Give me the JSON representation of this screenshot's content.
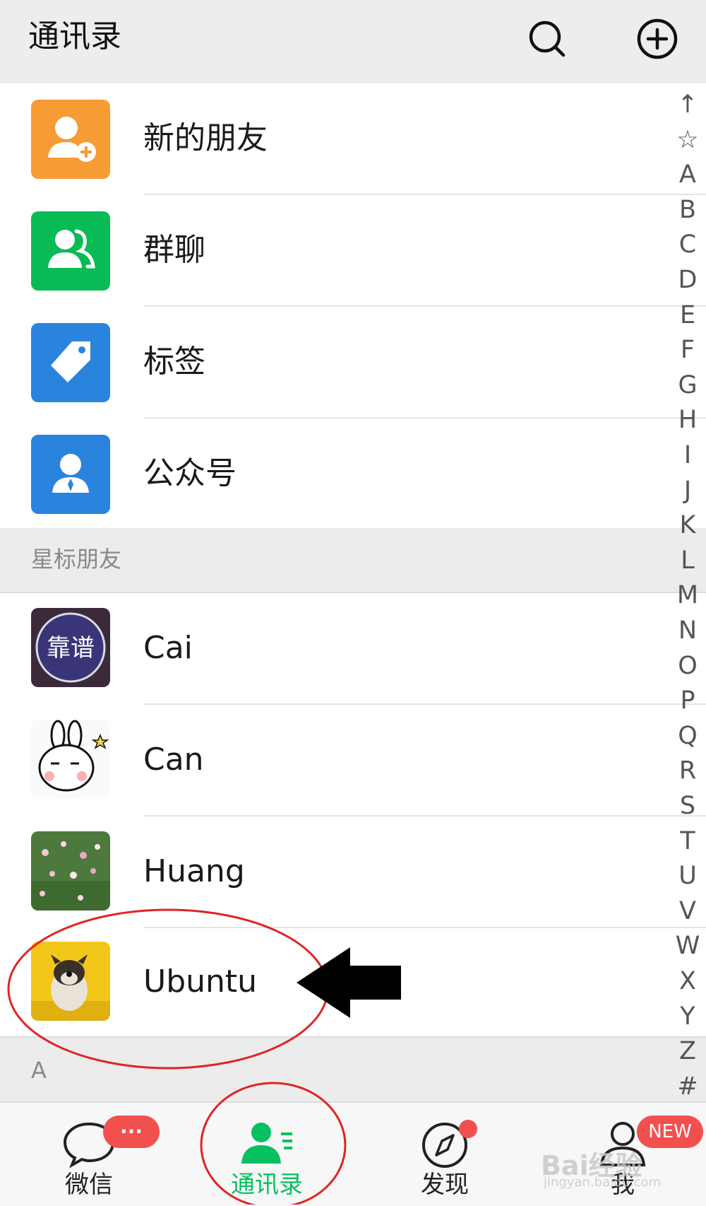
{
  "header": {
    "title": "通讯录",
    "search_icon": "search-icon",
    "add_icon": "plus-circle-icon"
  },
  "menu": [
    {
      "label": "新的朋友",
      "icon": "add-friend-icon",
      "color": "#f79c35"
    },
    {
      "label": "群聊",
      "icon": "group-icon",
      "color": "#09bb54"
    },
    {
      "label": "标签",
      "icon": "tag-icon",
      "color": "#2a84de"
    },
    {
      "label": "公众号",
      "icon": "official-account-icon",
      "color": "#2a84de"
    }
  ],
  "starred_section": {
    "title": "星标朋友"
  },
  "contacts": [
    {
      "name": "Cai",
      "avatar": "avatar-cai",
      "avatar_text": "靠谱"
    },
    {
      "name": "Can",
      "avatar": "avatar-can"
    },
    {
      "name": "Huang",
      "avatar": "avatar-huang"
    },
    {
      "name": "Ubuntu",
      "avatar": "avatar-ubuntu"
    }
  ],
  "a_section": {
    "title": "A"
  },
  "index_letters": [
    "↑",
    "☆",
    "A",
    "B",
    "C",
    "D",
    "E",
    "F",
    "G",
    "H",
    "I",
    "J",
    "K",
    "L",
    "M",
    "N",
    "O",
    "P",
    "Q",
    "R",
    "S",
    "T",
    "U",
    "V",
    "W",
    "X",
    "Y",
    "Z",
    "#"
  ],
  "tabs": [
    {
      "label": "微信",
      "icon": "chat-bubble-icon",
      "badge": "···",
      "active": false
    },
    {
      "label": "通讯录",
      "icon": "contacts-icon",
      "active": true
    },
    {
      "label": "发现",
      "icon": "compass-icon",
      "dot": true,
      "active": false
    },
    {
      "label": "我",
      "icon": "person-icon",
      "badge": "NEW",
      "active": false
    }
  ],
  "watermark": {
    "brand": "Bai经验",
    "url": "jingyan.baidu.com"
  },
  "colors": {
    "accent": "#07c160",
    "badge": "#f2504e",
    "annotation": "#e02424"
  }
}
